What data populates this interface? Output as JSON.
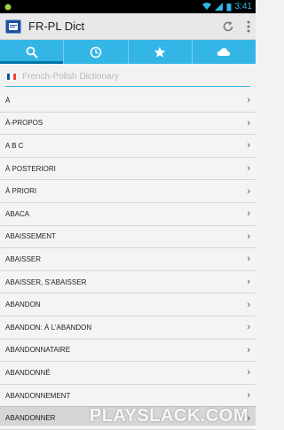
{
  "status_bar": {
    "time": "3:41",
    "left_icon": "android-bug-icon",
    "wifi_icon": "wifi-icon",
    "signal_icon": "signal-icon",
    "battery_icon": "battery-icon"
  },
  "app_bar": {
    "title": "FR-PL Dict",
    "icon": "dictionary-app-icon",
    "refresh_icon": "refresh-icon",
    "menu_icon": "overflow-menu-icon"
  },
  "tabs": [
    {
      "name": "search",
      "icon": "search-icon",
      "active": true
    },
    {
      "name": "history",
      "icon": "clock-icon",
      "active": false
    },
    {
      "name": "favorites",
      "icon": "star-icon",
      "active": false
    },
    {
      "name": "cloud",
      "icon": "cloud-icon",
      "active": false
    }
  ],
  "search": {
    "placeholder": "French-Polish Dictionary",
    "value": "",
    "flag_icon": "french-flag-icon"
  },
  "entries": [
    "À",
    "À-PROPOS",
    "A B C",
    "À POSTERIORI",
    "À PRIORI",
    "ABACA",
    "ABAISSEMENT",
    "ABAISSER",
    "ABAISSER, S'ABAISSER",
    "ABANDON",
    "ABANDON: À L'ABANDON",
    "ABANDONNATAIRE",
    "ABANDONNÉ",
    "ABANDONNEMENT",
    "ABANDONNER"
  ],
  "watermark": "PLAYSLACK.COM",
  "colors": {
    "accent": "#33b5e5",
    "indicator": "#0077a8",
    "status_bar": "#000000",
    "app_bar": "#e8e8e8"
  }
}
